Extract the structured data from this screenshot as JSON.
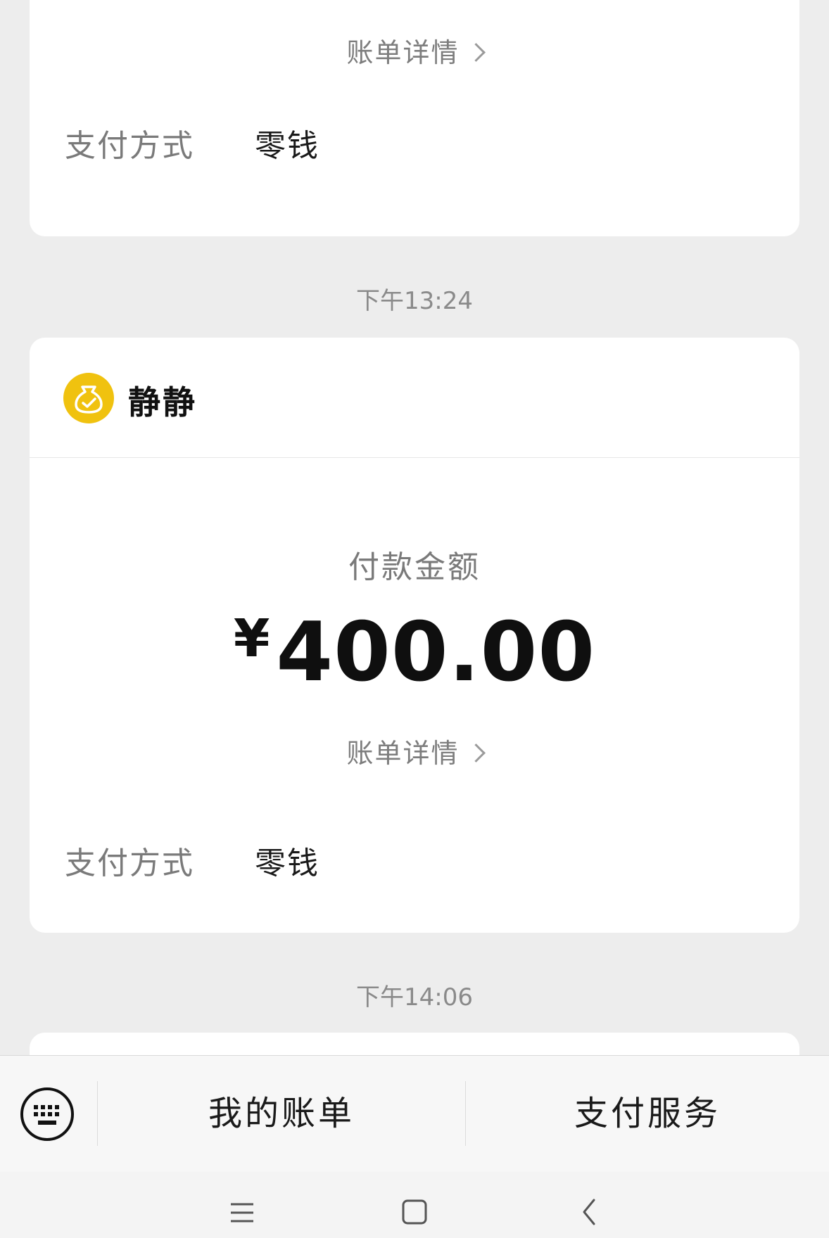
{
  "top_card": {
    "detail_link": "账单详情",
    "payment_method_label": "支付方式",
    "payment_method_value": "零钱"
  },
  "timestamp_1": "下午13:24",
  "main_card": {
    "merchant_name": "静静",
    "amount_label": "付款金额",
    "currency_symbol": "¥",
    "amount": "400.00",
    "detail_link": "账单详情",
    "payment_method_label": "支付方式",
    "payment_method_value": "零钱"
  },
  "timestamp_2": "下午14:06",
  "bottom_bar": {
    "keyboard_icon": "keyboard-icon",
    "tab_1": "我的账单",
    "tab_2": "支付服务"
  },
  "nav_bar": {
    "menu_icon": "menu-icon",
    "home_icon": "square-home-icon",
    "back_icon": "back-chevron-icon"
  },
  "colors": {
    "background": "#ededed",
    "card": "#ffffff",
    "merchant_icon": "#f0c20f"
  }
}
